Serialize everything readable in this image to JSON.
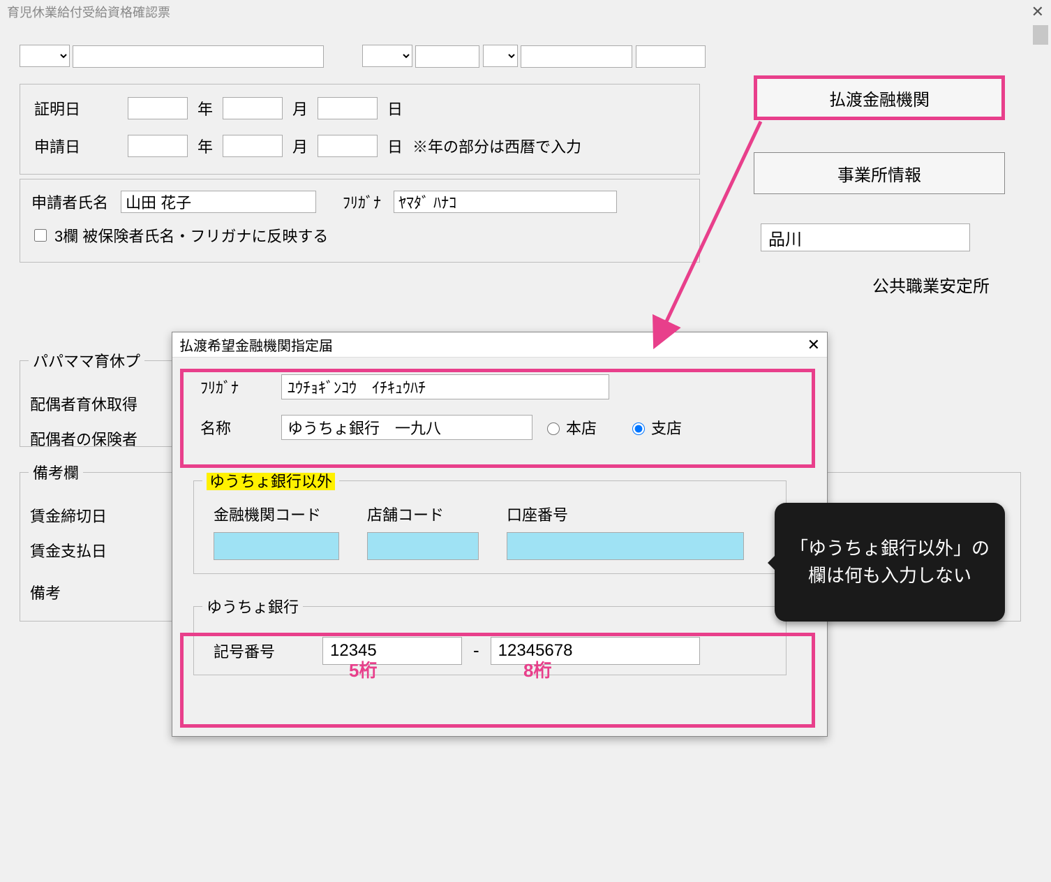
{
  "window": {
    "title": "育児休業給付受給資格確認票"
  },
  "date_section": {
    "row1": {
      "label": "証明日",
      "y": "年",
      "m": "月",
      "d": "日"
    },
    "row2": {
      "label": "申請日",
      "y": "年",
      "m": "月",
      "d": "日",
      "note": "※年の部分は西暦で入力"
    }
  },
  "applicant": {
    "name_label": "申請者氏名",
    "name": "山田 花子",
    "kana_label": "ﾌﾘｶﾞﾅ",
    "kana": "ﾔﾏﾀﾞ ﾊﾅｺ",
    "reflect_checkbox": "3欄 被保険者氏名・フリガナに反映する"
  },
  "right": {
    "bank_button": "払渡金融機関",
    "office_button": "事業所情報",
    "location_value": "品川",
    "location_label": "公共職業安定所"
  },
  "papa": {
    "legend": "パパママ育休プ",
    "line1": "配偶者育休取得",
    "line2": "配偶者の保険者"
  },
  "remarks": {
    "legend": "備考欄",
    "l1": "賃金締切日",
    "l2": "賃金支払日",
    "l3": "備考"
  },
  "dialog": {
    "title": "払渡希望金融機関指定届",
    "furigana_label": "ﾌﾘｶﾞﾅ",
    "furigana_value": "ﾕｳﾁｮｷﾞﾝｺｳ　ｲﾁｷｭｳﾊﾁ",
    "name_label": "名称",
    "name_value": "ゆうちょ銀行　一九八",
    "radio_main": "本店",
    "radio_branch": "支店",
    "other_bank": {
      "legend": "ゆうちょ銀行以外",
      "col1": "金融機関コード",
      "col2": "店舗コード",
      "col3": "口座番号"
    },
    "yuucho": {
      "legend": "ゆうちょ銀行",
      "label": "記号番号",
      "part1": "12345",
      "dash": "-",
      "part2": "12345678"
    }
  },
  "annotations": {
    "digits5": "5桁",
    "digits8": "8桁",
    "callout": "「ゆうちょ銀行以外」の欄は何も入力しない"
  }
}
